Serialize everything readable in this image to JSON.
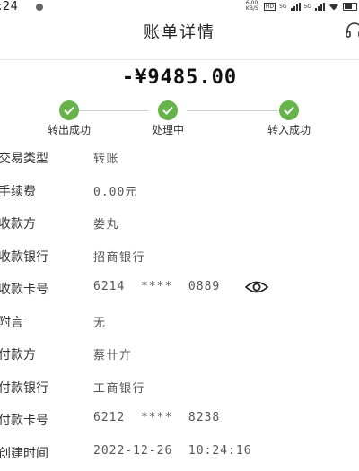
{
  "status_bar": {
    "time": ":24",
    "network_speed": "6.00 KB/S",
    "hd_badge": "HD",
    "signal_1": "5G",
    "signal_2": "5G"
  },
  "header": {
    "title": "账单详情",
    "support_icon": "headset-icon"
  },
  "amount": "-¥9485.00",
  "progress": {
    "steps": [
      {
        "label": "转出成功",
        "status": "done"
      },
      {
        "label": "处理中",
        "status": "done"
      },
      {
        "label": "转入成功",
        "status": "done"
      }
    ],
    "color": "#66b34a"
  },
  "details": [
    {
      "label": "交易类型",
      "value": "转账"
    },
    {
      "label": "手续费",
      "value": "0.00元"
    },
    {
      "label": "收款方",
      "value": "娄丸"
    },
    {
      "label": "收款银行",
      "value": "招商银行"
    },
    {
      "label": "收款卡号",
      "value": "6214  ****  0889"
    },
    {
      "label": "附言",
      "value": "无"
    },
    {
      "label": "付款方",
      "value": "蔡卄亣"
    },
    {
      "label": "付款银行",
      "value": "工商银行"
    },
    {
      "label": "付款卡号",
      "value": "6212  ****  8238"
    },
    {
      "label": "创建时间",
      "value": "2022-12-26  10:24:16"
    }
  ]
}
